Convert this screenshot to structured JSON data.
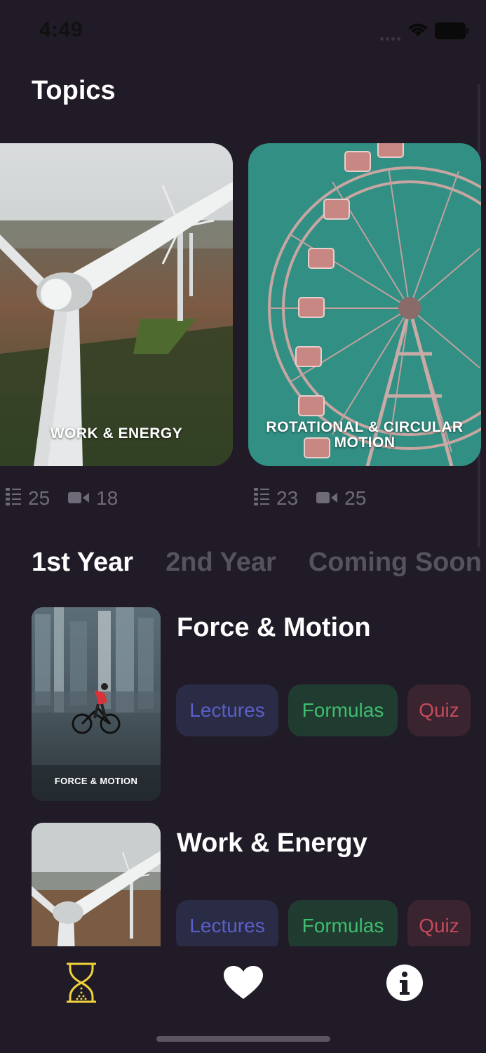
{
  "status": {
    "time": "4:49"
  },
  "header": {
    "title": "Topics"
  },
  "topics": [
    {
      "label": "WORK & ENERGY",
      "lectures": "25",
      "videos": "18"
    },
    {
      "label": "ROTATIONAL & CIRCULAR MOTION",
      "lectures": "23",
      "videos": "25"
    }
  ],
  "tabs": [
    {
      "label": "1st Year",
      "active": true
    },
    {
      "label": "2nd Year",
      "active": false
    },
    {
      "label": "Coming Soon",
      "active": false
    }
  ],
  "courses": [
    {
      "title": "Force & Motion",
      "thumb_label": "FORCE & MOTION",
      "lectures_label": "Lectures",
      "formulas_label": "Formulas",
      "quiz_label": "Quiz"
    },
    {
      "title": "Work & Energy",
      "thumb_label": "",
      "lectures_label": "Lectures",
      "formulas_label": "Formulas",
      "quiz_label": "Quiz"
    }
  ],
  "nav": {
    "items": [
      {
        "icon": "hourglass-icon",
        "active": true
      },
      {
        "icon": "heart-icon",
        "active": false
      },
      {
        "icon": "info-icon",
        "active": false
      }
    ]
  },
  "colors": {
    "background": "#201b26",
    "accent_active_nav": "#f2d23c",
    "lectures": "#5a5fc8",
    "formulas": "#3fbd6e",
    "quiz": "#c54a5d"
  }
}
